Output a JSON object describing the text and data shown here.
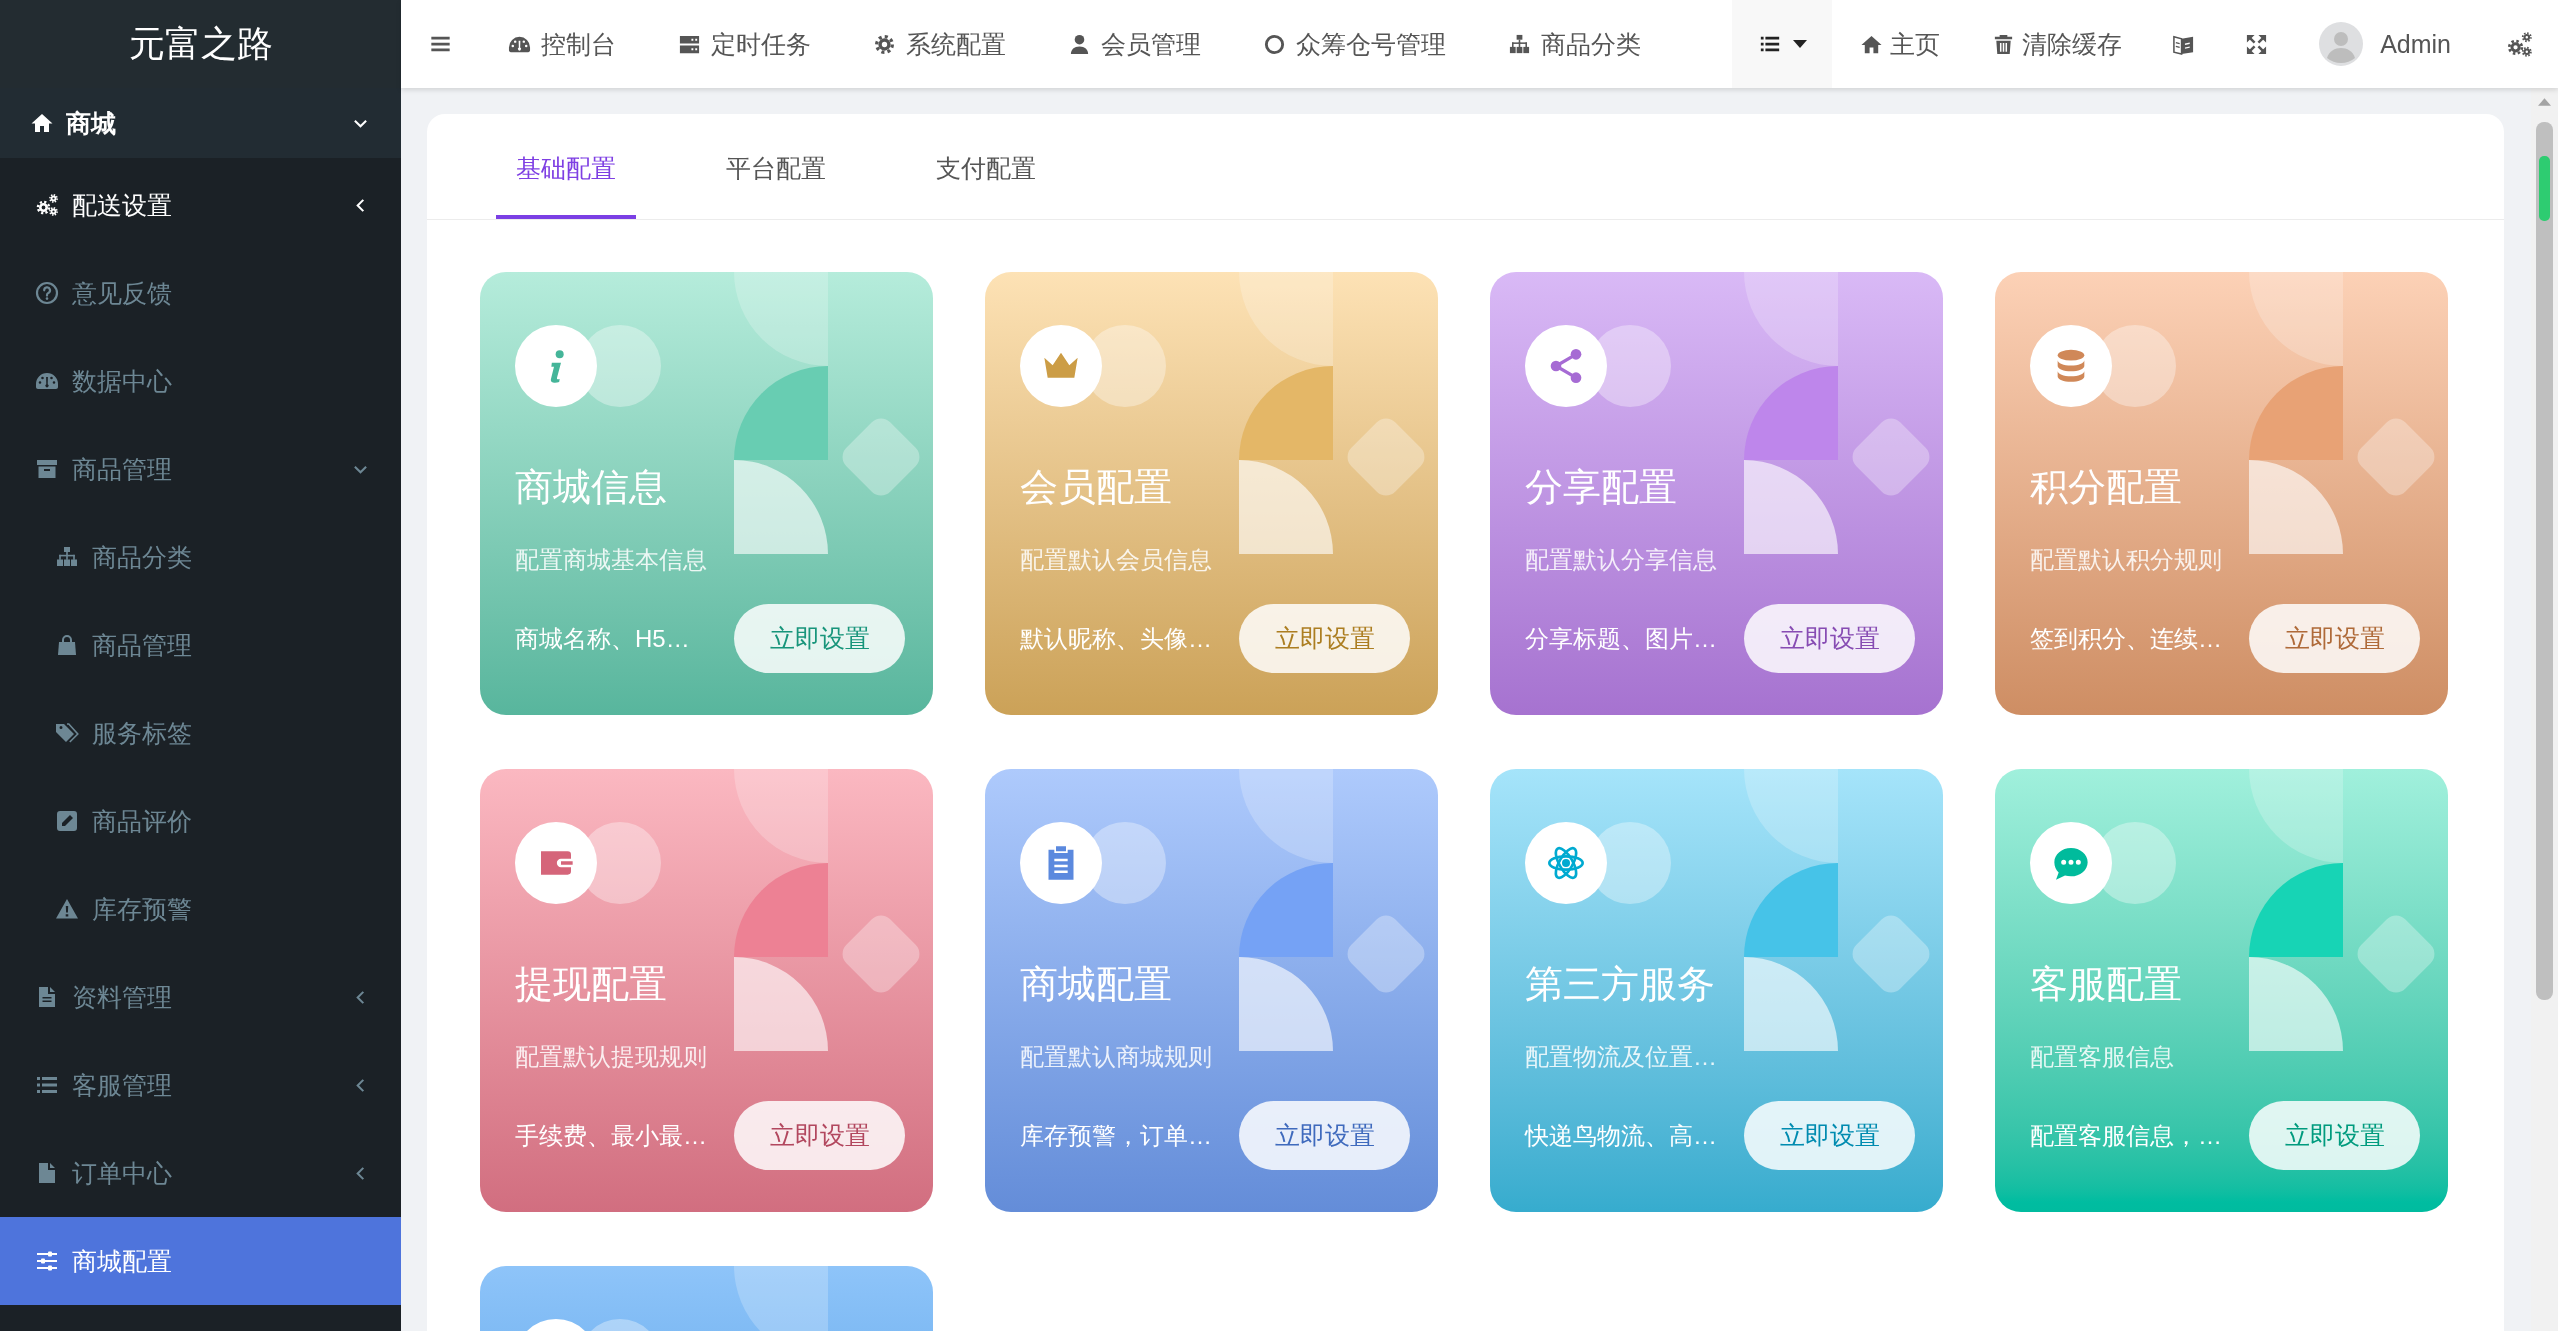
{
  "sidebar": {
    "logo": "元富之路",
    "menu": {
      "label": "商城",
      "expanded": true,
      "items": [
        {
          "kind": "group",
          "label": "配送设置",
          "expanded": false,
          "highlighted": true,
          "selected": false
        },
        {
          "kind": "link",
          "label": "意见反馈",
          "highlighted": false,
          "selected": false
        },
        {
          "kind": "link",
          "label": "数据中心",
          "highlighted": false,
          "selected": false
        },
        {
          "kind": "group",
          "label": "商品管理",
          "expanded": true,
          "highlighted": false,
          "selected": false,
          "children": [
            {
              "label": "商品分类",
              "highlighted": false,
              "selected": false
            },
            {
              "label": "商品管理",
              "highlighted": false,
              "selected": false
            },
            {
              "label": "服务标签",
              "highlighted": false,
              "selected": false
            },
            {
              "label": "商品评价",
              "highlighted": false,
              "selected": false
            },
            {
              "label": "库存预警",
              "highlighted": false,
              "selected": false
            }
          ]
        },
        {
          "kind": "group",
          "label": "资料管理",
          "expanded": false,
          "highlighted": false,
          "selected": false
        },
        {
          "kind": "group",
          "label": "客服管理",
          "expanded": false,
          "highlighted": false,
          "selected": false
        },
        {
          "kind": "group",
          "label": "订单中心",
          "expanded": false,
          "highlighted": false,
          "selected": false
        },
        {
          "kind": "link",
          "label": "商城配置",
          "highlighted": false,
          "selected": true
        }
      ]
    }
  },
  "topbar": {
    "nav": [
      "控制台",
      "定时任务",
      "系统配置",
      "会员管理",
      "众筹仓号管理",
      "商品分类"
    ],
    "links": [
      "主页",
      "清除缓存"
    ],
    "user": {
      "name": "Admin"
    }
  },
  "tabs": [
    {
      "label": "基础配置",
      "selected": true
    },
    {
      "label": "平台配置",
      "selected": false
    },
    {
      "label": "支付配置",
      "selected": false
    }
  ],
  "cards": [
    {
      "title": "商城信息",
      "subtitle": "配置商城基本信息",
      "summary": "商城名称、H5…",
      "button": "立即设置",
      "color": "#b5ecdb"
    },
    {
      "title": "会员配置",
      "subtitle": "配置默认会员信息",
      "summary": "默认昵称、头像…",
      "button": "立即设置",
      "color": "#fde2b5"
    },
    {
      "title": "分享配置",
      "subtitle": "配置默认分享信息",
      "summary": "分享标题、图片…",
      "button": "立即设置",
      "color": "#d9b9f6"
    },
    {
      "title": "积分配置",
      "subtitle": "配置默认积分规则",
      "summary": "签到积分、连续…",
      "button": "立即设置",
      "color": "#fcd1b6"
    },
    {
      "title": "提现配置",
      "subtitle": "配置默认提现规则",
      "summary": "手续费、最小最…",
      "button": "立即设置",
      "color": "#fbb8c1"
    },
    {
      "title": "商城配置",
      "subtitle": "配置默认商城规则",
      "summary": "库存预警，订单…",
      "button": "立即设置",
      "color": "#aecafc"
    },
    {
      "title": "第三方服务",
      "subtitle": "配置物流及位置…",
      "summary": "快递鸟物流、高…",
      "button": "立即设置",
      "color": "#a5e4fa"
    },
    {
      "title": "客服配置",
      "subtitle": "配置客服信息",
      "summary": "配置客服信息，…",
      "button": "立即设置",
      "color": "#a0f0dc"
    },
    {
      "color": "#8ec4f9"
    }
  ]
}
